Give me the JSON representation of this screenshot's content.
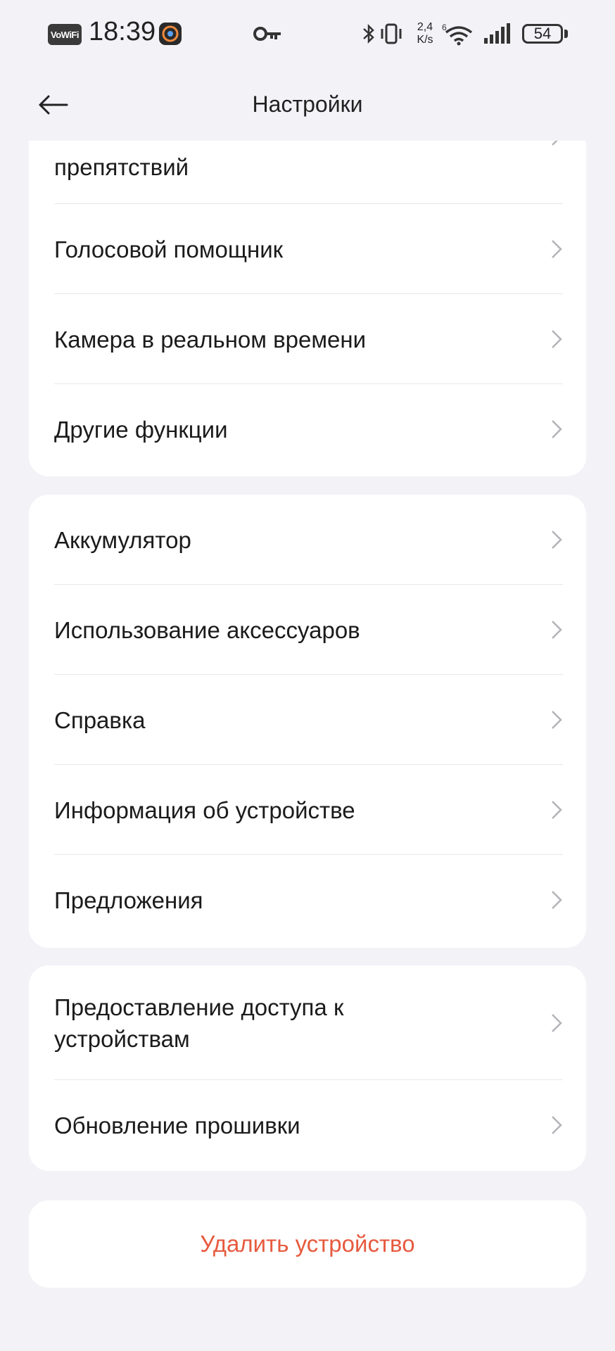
{
  "status_bar": {
    "vowifi": "VoWiFi",
    "time": "18:39",
    "net_speed_value": "2,4",
    "net_speed_unit": "K/s",
    "wifi_label": "6",
    "battery": "54"
  },
  "header": {
    "title": "Настройки"
  },
  "card1": {
    "items": [
      {
        "label": "препятствий"
      },
      {
        "label": "Голосовой помощник"
      },
      {
        "label": "Камера в реальном времени"
      },
      {
        "label": "Другие функции"
      }
    ]
  },
  "card2": {
    "items": [
      {
        "label": "Аккумулятор"
      },
      {
        "label": "Использование аксессуаров"
      },
      {
        "label": "Справка"
      },
      {
        "label": "Информация об устройстве"
      },
      {
        "label": "Предложения"
      }
    ]
  },
  "card3": {
    "items": [
      {
        "label_line1": "Предоставление доступа к",
        "label_line2": "устройствам"
      },
      {
        "label": "Обновление прошивки"
      }
    ]
  },
  "delete_button": "Удалить устройство",
  "colors": {
    "background": "#f3f2f7",
    "card": "#ffffff",
    "danger": "#e65a3e"
  }
}
